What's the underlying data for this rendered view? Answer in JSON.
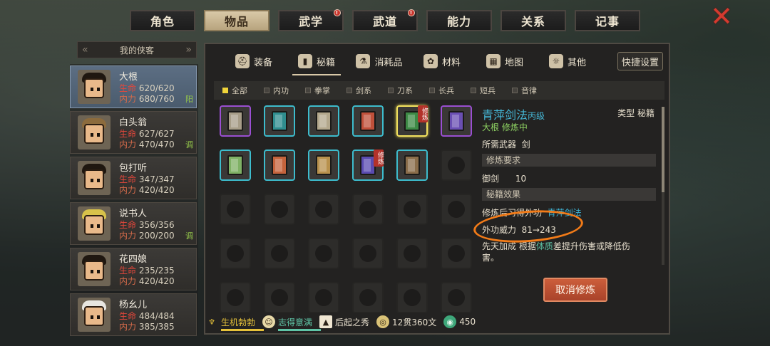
{
  "top_tabs": [
    {
      "label": "角色",
      "active": false,
      "dot": false
    },
    {
      "label": "物品",
      "active": true,
      "dot": false
    },
    {
      "label": "武学",
      "active": false,
      "dot": true
    },
    {
      "label": "武道",
      "active": false,
      "dot": true
    },
    {
      "label": "能力",
      "active": false,
      "dot": false
    },
    {
      "label": "关系",
      "active": false,
      "dot": false
    },
    {
      "label": "记事",
      "active": false,
      "dot": false
    }
  ],
  "close_icon": "✕",
  "party": {
    "header": "我的侠客",
    "members": [
      {
        "name": "大根",
        "hp_label": "生命",
        "hp": "620/620",
        "mp_label": "内力",
        "mp": "680/760",
        "tag": "阳"
      },
      {
        "name": "白头翁",
        "hp_label": "生命",
        "hp": "627/627",
        "mp_label": "内力",
        "mp": "470/470",
        "tag": "调"
      },
      {
        "name": "包打听",
        "hp_label": "生命",
        "hp": "347/347",
        "mp_label": "内力",
        "mp": "420/420",
        "tag": ""
      },
      {
        "name": "说书人",
        "hp_label": "生命",
        "hp": "356/356",
        "mp_label": "内力",
        "mp": "200/200",
        "tag": "调"
      },
      {
        "name": "花四娘",
        "hp_label": "生命",
        "hp": "235/235",
        "mp_label": "内力",
        "mp": "420/420",
        "tag": ""
      },
      {
        "name": "杨幺儿",
        "hp_label": "生命",
        "hp": "484/484",
        "mp_label": "内力",
        "mp": "385/385",
        "tag": ""
      }
    ]
  },
  "sub_tabs": [
    {
      "label": "装备",
      "icon": "helmet-icon"
    },
    {
      "label": "秘籍",
      "icon": "book-icon"
    },
    {
      "label": "消耗品",
      "icon": "potion-icon"
    },
    {
      "label": "材料",
      "icon": "herb-icon"
    },
    {
      "label": "地图",
      "icon": "map-icon"
    },
    {
      "label": "其他",
      "icon": "misc-icon"
    }
  ],
  "quick_settings": "快捷设置",
  "filters": [
    "全部",
    "内功",
    "拳掌",
    "剑系",
    "刀系",
    "长兵",
    "短兵",
    "音律"
  ],
  "inventory": {
    "items": [
      {
        "color": "#a79d88",
        "frame": "purple",
        "badge": ""
      },
      {
        "color": "#2f8d8f",
        "frame": "teal",
        "badge": ""
      },
      {
        "color": "#b3a78c",
        "frame": "teal",
        "badge": ""
      },
      {
        "color": "#c0503a",
        "frame": "teal",
        "badge": ""
      },
      {
        "color": "#3d8a45",
        "frame": "selected",
        "badge": "修炼"
      },
      {
        "color": "#6a4fb3",
        "frame": "purple",
        "badge": ""
      },
      {
        "color": "#7fb165",
        "frame": "teal",
        "badge": ""
      },
      {
        "color": "#c4633c",
        "frame": "teal",
        "badge": ""
      },
      {
        "color": "#b8914d",
        "frame": "teal",
        "badge": ""
      },
      {
        "color": "#5a4bb0",
        "frame": "teal",
        "badge": "修炼"
      },
      {
        "color": "#8a6d4a",
        "frame": "teal",
        "badge": ""
      }
    ]
  },
  "detail": {
    "title": "青萍剑法",
    "grade": "丙级",
    "type_label": "类型 秘籍",
    "status": "大根 修炼中",
    "weapon_label": "所需武器",
    "weapon": "剑",
    "req_section": "修炼要求",
    "req_name": "御剑",
    "req_value": "10",
    "effect_section": "秘籍效果",
    "effect_text": "修炼后习得外功",
    "effect_skill": "青萍剑法",
    "power_label": "外功威力",
    "power_value": "81→243",
    "talent_label": "先天加成",
    "talent_text_a": "根据",
    "talent_attr": "体质",
    "talent_text_b": "差提升伤害或降低伤害。"
  },
  "cancel_button": "取消修炼",
  "status": [
    {
      "label": "生机勃勃",
      "color": "#e6c23a"
    },
    {
      "label": "志得意满",
      "color": "#5fc4a6"
    },
    {
      "label": "后起之秀",
      "color": "#efe6d2"
    },
    {
      "label": "12贯360文",
      "color": "#efe6d2"
    },
    {
      "label": "450",
      "color": "#efe6d2"
    }
  ]
}
